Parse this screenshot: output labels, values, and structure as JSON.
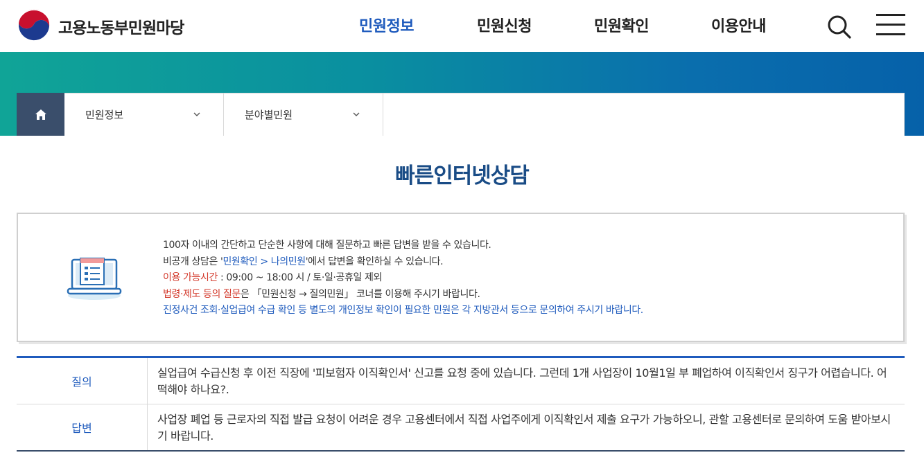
{
  "header": {
    "site_name": "고용노동부민원마당",
    "nav": [
      {
        "label": "민원정보",
        "active": true
      },
      {
        "label": "민원신청",
        "active": false
      },
      {
        "label": "민원확인",
        "active": false
      },
      {
        "label": "이용안내",
        "active": false
      }
    ],
    "icons": {
      "search": "search-icon",
      "menu": "hamburger-icon"
    }
  },
  "location": {
    "home_icon": "home-icon",
    "level1": "민원정보",
    "level2": "분야별민원"
  },
  "page": {
    "title": "빠른인터넷상담"
  },
  "info": {
    "line1": "100자 이내의 간단하고 단순한 사항에 대해 질문하고 빠른 답변을 받을 수 있습니다.",
    "line2_pre": "비공개 상담은 '",
    "line2_link": "민원확인 > 나의민원",
    "line2_post": "'에서 답변을 확인하실 수 있습니다.",
    "line3_label": "이용 가능시간",
    "line3_text": " : 09:00 ~ 18:00 시 / 토·일·공휴일 제외",
    "line4_label": "법령·제도 등의 질문",
    "line4_text": "은 「민원신청 → 질의민원」 코너를 이용해 주시기 바랍니다.",
    "line5": "진정사건 조회·실업급여 수급 확인 등 별도의 개인정보 확인이 필요한 민원은 각 지방관서 등으로 문의하여 주시기 바랍니다."
  },
  "qa": {
    "question_label": "질의",
    "question_text": "실업급여 수급신청 후 이전 직장에 '피보험자 이직확인서' 신고를 요청 중에 있습니다. 그런데 1개 사업장이 10월1일 부 폐업하여 이직확인서 징구가 어렵습니다. 어떡해야 하나요?.",
    "answer_label": "답변",
    "answer_text": "사업장 폐업 등 근로자의 직접 발급 요청이 어려운 경우 고용센터에서 직접 사업주에게 이직확인서 제출 요구가 가능하오니, 관할 고용센터로 문의하여 도움 받아보시기 바랍니다."
  },
  "colors": {
    "accent": "#1f5bbd",
    "title": "#1a4c86",
    "highlight_red": "#d33a2c",
    "home_bg": "#3a4e6b"
  }
}
